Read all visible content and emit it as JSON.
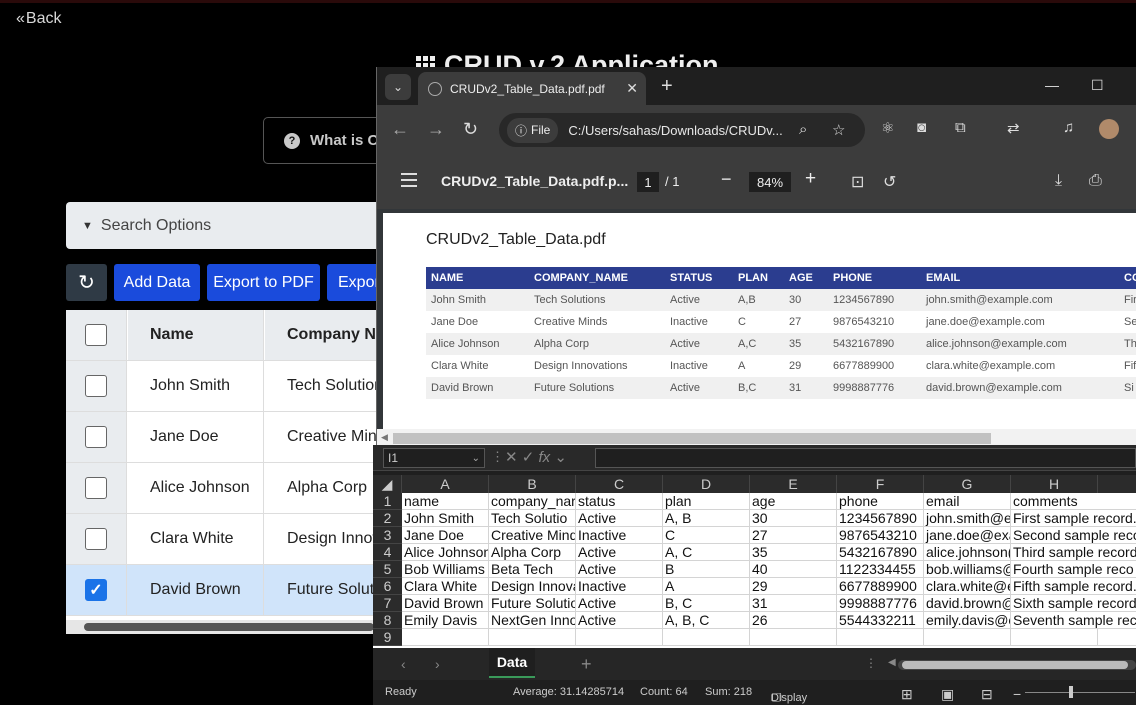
{
  "app": {
    "back_label": "Back",
    "title": "CRUD v.2 Application",
    "whatis_label": "What is CRUD",
    "search_options": "Search Options",
    "buttons": {
      "add": "Add Data",
      "export_pdf": "Export to PDF",
      "export_excel": "Expor"
    },
    "table": {
      "headers": {
        "name": "Name",
        "company": "Company Name"
      },
      "rows": [
        {
          "name": "John Smith",
          "company": "Tech Solutions",
          "checked": false
        },
        {
          "name": "Jane Doe",
          "company": "Creative Minds",
          "checked": false
        },
        {
          "name": "Alice Johnson",
          "company": "Alpha Corp",
          "checked": false
        },
        {
          "name": "Clara White",
          "company": "Design Innovations",
          "checked": false
        },
        {
          "name": "David Brown",
          "company": "Future Solutions",
          "checked": true
        }
      ]
    }
  },
  "browser": {
    "tab_title": "CRUDv2_Table_Data.pdf.pdf",
    "file_chip": "File",
    "url": "C:/Users/sahas/Downloads/CRUDv...",
    "pdf_toolbar": {
      "filename": "CRUDv2_Table_Data.pdf.p...",
      "page": "1",
      "total": "/  1",
      "zoom": "84%"
    }
  },
  "pdf": {
    "title": "CRUDv2_Table_Data.pdf",
    "headers": [
      "NAME",
      "COMPANY_NAME",
      "STATUS",
      "PLAN",
      "AGE",
      "PHONE",
      "EMAIL",
      "CO"
    ],
    "rows": [
      [
        "John Smith",
        "Tech Solutions",
        "Active",
        "A,B",
        "30",
        "1234567890",
        "john.smith@example.com",
        "Fir"
      ],
      [
        "Jane Doe",
        "Creative Minds",
        "Inactive",
        "C",
        "27",
        "9876543210",
        "jane.doe@example.com",
        "Se"
      ],
      [
        "Alice Johnson",
        "Alpha Corp",
        "Active",
        "A,C",
        "35",
        "5432167890",
        "alice.johnson@example.com",
        "Th"
      ],
      [
        "Clara White",
        "Design Innovations",
        "Inactive",
        "A",
        "29",
        "6677889900",
        "clara.white@example.com",
        "Fif"
      ],
      [
        "David Brown",
        "Future Solutions",
        "Active",
        "B,C",
        "31",
        "9998887776",
        "david.brown@example.com",
        "Si"
      ]
    ]
  },
  "excel": {
    "name_box": "I1",
    "fx": "fx",
    "columns": [
      "A",
      "B",
      "C",
      "D",
      "E",
      "F",
      "G",
      "H"
    ],
    "rows": [
      [
        "name",
        "company_nar",
        "status",
        "plan",
        "age",
        "phone",
        "email",
        "comments"
      ],
      [
        "John Smith",
        "Tech Solutio",
        "Active",
        "A, B",
        "30",
        "1234567890",
        "john.smith@e",
        "First sample record."
      ],
      [
        "Jane Doe",
        "Creative Mind",
        "Inactive",
        "C",
        "27",
        "9876543210",
        "jane.doe@exa",
        "Second sample reco"
      ],
      [
        "Alice Johnson",
        "Alpha Corp",
        "Active",
        "A, C",
        "35",
        "5432167890",
        "alice.johnson(",
        "Third sample record"
      ],
      [
        "Bob Williams",
        "Beta Tech",
        "Active",
        "B",
        "40",
        "1122334455",
        "bob.williams@",
        "Fourth sample reco"
      ],
      [
        "Clara White",
        "Design Innova",
        "Inactive",
        "A",
        "29",
        "6677889900",
        "clara.white@e",
        "Fifth sample record."
      ],
      [
        "David Brown",
        "Future Solutio",
        "Active",
        "B, C",
        "31",
        "9998887776",
        "david.brown@",
        "Sixth sample record"
      ],
      [
        "Emily Davis",
        "NextGen Inno",
        "Active",
        "A, B, C",
        "26",
        "5544332211",
        "emily.davis@e",
        "Seventh sample reco"
      ]
    ],
    "sheet_tab": "Data",
    "status": {
      "ready": "Ready",
      "average": "Average: 31.14285714",
      "count": "Count: 64",
      "sum": "Sum: 218",
      "display_settings": "Display Settings"
    }
  }
}
